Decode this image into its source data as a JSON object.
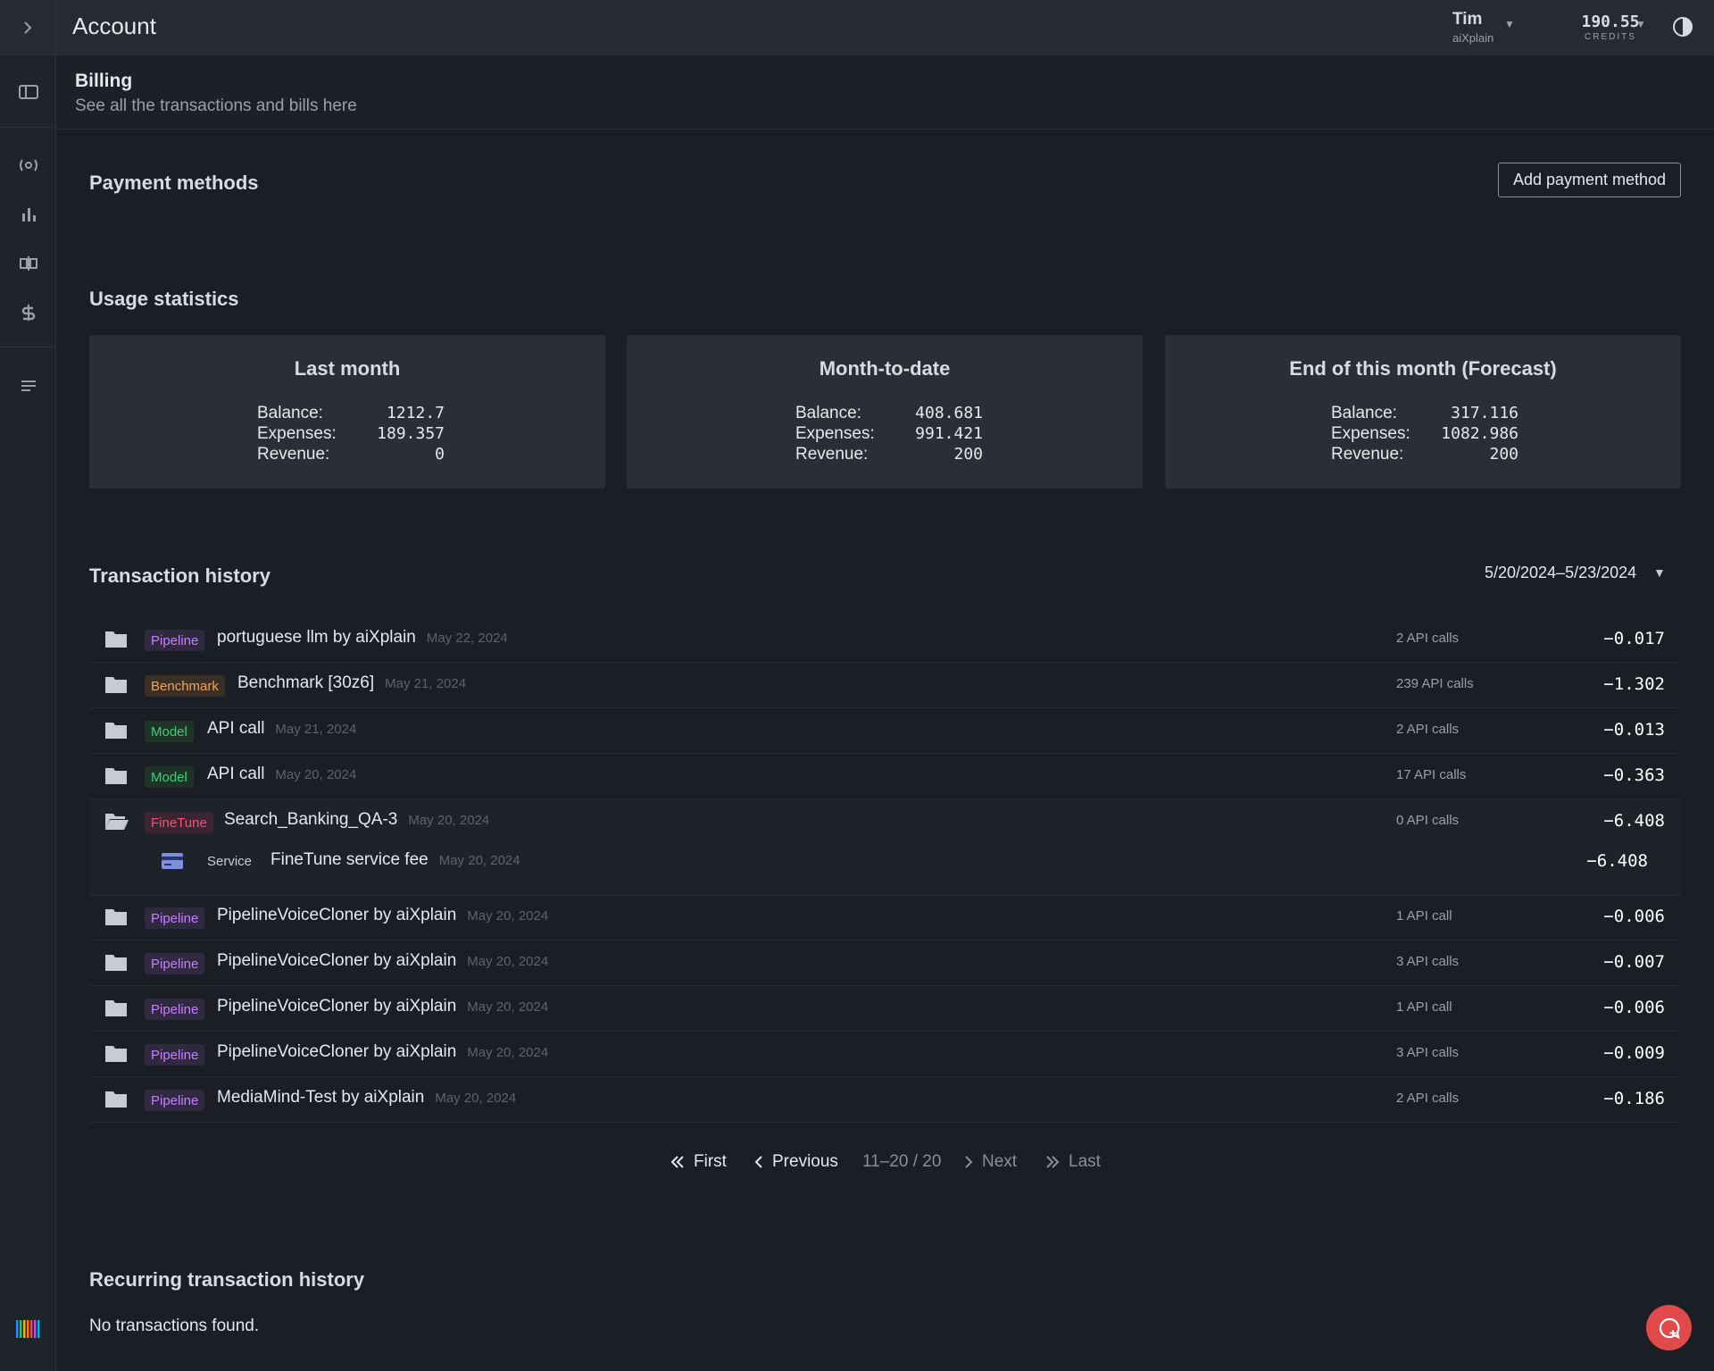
{
  "header": {
    "title": "Account",
    "user_name": "Tim",
    "user_org": "aiXplain",
    "credits_value": "190.55",
    "credits_label": "CREDITS"
  },
  "billing": {
    "title": "Billing",
    "subtitle": "See all the transactions and bills here"
  },
  "payment_methods": {
    "title": "Payment methods",
    "add_button": "Add payment method"
  },
  "usage": {
    "title": "Usage statistics",
    "cards": [
      {
        "title": "Last month",
        "balance_label": "Balance:",
        "balance": "1212.7",
        "expenses_label": "Expenses:",
        "expenses": "189.357",
        "revenue_label": "Revenue:",
        "revenue": "0"
      },
      {
        "title": "Month-to-date",
        "balance_label": "Balance:",
        "balance": "408.681",
        "expenses_label": "Expenses:",
        "expenses": "991.421",
        "revenue_label": "Revenue:",
        "revenue": "200"
      },
      {
        "title": "End of this month (Forecast)",
        "balance_label": "Balance:",
        "balance": "317.116",
        "expenses_label": "Expenses:",
        "expenses": "1082.986",
        "revenue_label": "Revenue:",
        "revenue": "200"
      }
    ]
  },
  "transactions": {
    "title": "Transaction history",
    "date_range": "5/20/2024–5/23/2024",
    "rows": [
      {
        "tag": "Pipeline",
        "name": "portuguese llm by aiXplain",
        "date": "May 22, 2024",
        "calls": "2 API calls",
        "amount": "−0.017"
      },
      {
        "tag": "Benchmark",
        "name": "Benchmark [30z6]",
        "date": "May 21, 2024",
        "calls": "239 API calls",
        "amount": "−1.302"
      },
      {
        "tag": "Model",
        "name": "API call",
        "date": "May 21, 2024",
        "calls": "2 API calls",
        "amount": "−0.013"
      },
      {
        "tag": "Model",
        "name": "API call",
        "date": "May 20, 2024",
        "calls": "17 API calls",
        "amount": "−0.363"
      },
      {
        "tag": "FineTune",
        "name": "Search_Banking_QA-3",
        "date": "May 20, 2024",
        "calls": "0 API calls",
        "amount": "−6.408"
      },
      {
        "tag": "Pipeline",
        "name": "PipelineVoiceCloner by aiXplain",
        "date": "May 20, 2024",
        "calls": "1 API call",
        "amount": "−0.006"
      },
      {
        "tag": "Pipeline",
        "name": "PipelineVoiceCloner by aiXplain",
        "date": "May 20, 2024",
        "calls": "3 API calls",
        "amount": "−0.007"
      },
      {
        "tag": "Pipeline",
        "name": "PipelineVoiceCloner by aiXplain",
        "date": "May 20, 2024",
        "calls": "1 API call",
        "amount": "−0.006"
      },
      {
        "tag": "Pipeline",
        "name": "PipelineVoiceCloner by aiXplain",
        "date": "May 20, 2024",
        "calls": "3 API calls",
        "amount": "−0.009"
      },
      {
        "tag": "Pipeline",
        "name": "MediaMind-Test by aiXplain",
        "date": "May 20, 2024",
        "calls": "2 API calls",
        "amount": "−0.186"
      }
    ],
    "sub_row": {
      "tag": "Service",
      "name": "FineTune service fee",
      "date": "May 20, 2024",
      "amount": "−6.408"
    }
  },
  "pagination": {
    "first": "First",
    "previous": "Previous",
    "range": "11–20 / 20",
    "next": "Next",
    "last": "Last"
  },
  "recurring": {
    "title": "Recurring transaction history",
    "empty": "No transactions found."
  },
  "colors": {
    "pipeline": "#c77dff",
    "benchmark": "#f0a45b",
    "model": "#3bd17a",
    "finetune": "#f0527e",
    "fab": "#e04a4a"
  }
}
